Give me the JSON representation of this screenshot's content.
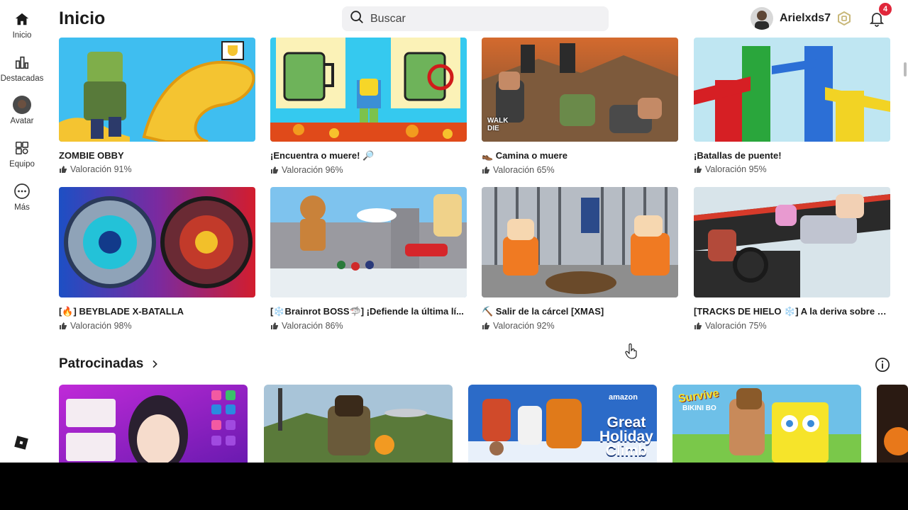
{
  "header": {
    "title": "Inicio",
    "search_placeholder": "Buscar",
    "username": "Arielxds7",
    "notification_count": "4"
  },
  "sidebar": {
    "items": [
      {
        "label": "Inicio",
        "icon": "home-icon"
      },
      {
        "label": "Destacadas",
        "icon": "chart-icon"
      },
      {
        "label": "Avatar",
        "icon": "avatar-icon"
      },
      {
        "label": "Equipo",
        "icon": "group-icon"
      },
      {
        "label": "Más",
        "icon": "more-icon"
      }
    ]
  },
  "games": [
    {
      "title": "ZOMBIE OBBY",
      "rating": "Valoración 91%"
    },
    {
      "title": "¡Encuentra o muere! 🔎",
      "rating": "Valoración 96%"
    },
    {
      "title": "👞 Camina o muere",
      "rating": "Valoración 65%"
    },
    {
      "title": "¡Batallas de puente!",
      "rating": "Valoración 95%"
    },
    {
      "title": "[🔥] BEYBLADE X-BATALLA",
      "rating": "Valoración 98%"
    },
    {
      "title": "[❄️Brainrot BOSS🦈] ¡Defiende la última lí...",
      "rating": "Valoración 86%"
    },
    {
      "title": "⛏️ Salir de la cárcel [XMAS]",
      "rating": "Valoración 92%"
    },
    {
      "title": "[TRACKS DE HIELO ❄️] A la deriva sobre u...",
      "rating": "Valoración 75%"
    }
  ],
  "thumb_text": {
    "walk_die": "WALK\nDIE",
    "amazon": "amazon",
    "great": "Great",
    "holiday": "Holiday",
    "climb": "Climb",
    "survive": "Survive",
    "bikini": "BIKINI BO"
  },
  "sponsored": {
    "title": "Patrocinadas"
  },
  "colors": {
    "badge": "#e0263a",
    "text": "#1b1b1b"
  }
}
